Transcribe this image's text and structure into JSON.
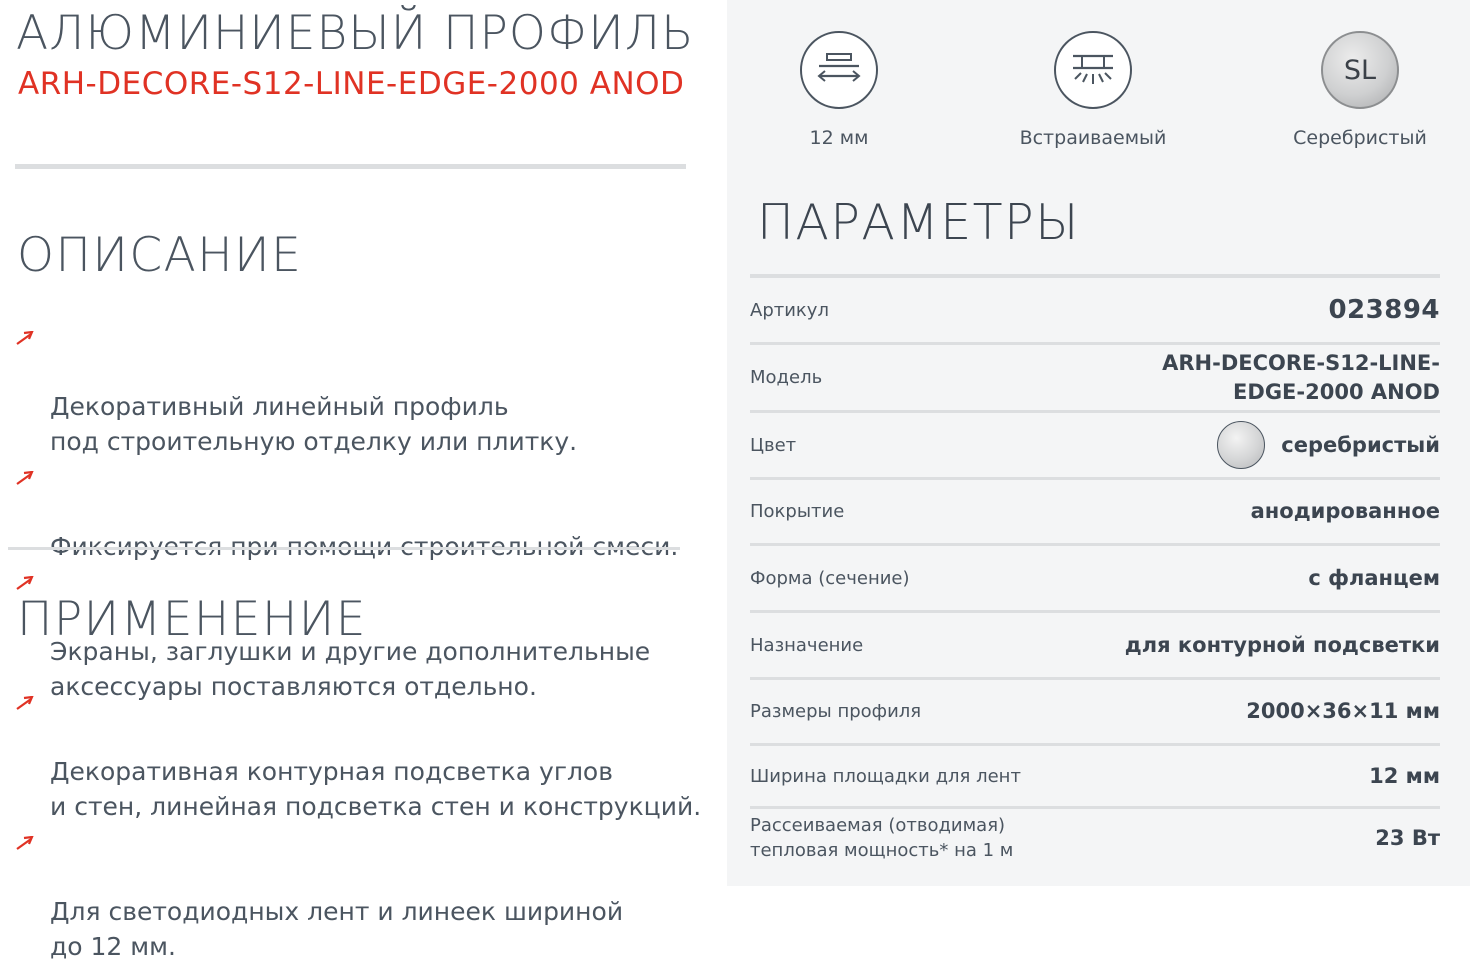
{
  "header": {
    "title": "АЛЮМИНИЕВЫЙ ПРОФИЛЬ",
    "model": "ARH-DECORE-S12-LINE-EDGE-2000 ANOD"
  },
  "description": {
    "title": "ОПИСАНИЕ",
    "items": [
      "Декоративный линейный профиль\nпод строительную отделку или плитку.",
      "Фиксируется при помощи строительной смеси.",
      "Экраны, заглушки и другие дополнительные\nаксессуары поставляются отдельно."
    ]
  },
  "application": {
    "title": "ПРИМЕНЕНИЕ",
    "items": [
      "Декоративная контурная подсветка углов\nи стен, линейная подсветка стен и конструкций.",
      "Для светодиодных лент и линеек шириной\nдо 12 мм."
    ]
  },
  "features": [
    {
      "icon": "width-arrows-icon",
      "label": "12 мм"
    },
    {
      "icon": "recessed-mount-icon",
      "label": "Встраиваемый"
    },
    {
      "icon": "silver-color-icon",
      "badge": "SL",
      "label": "Серебристый"
    }
  ],
  "params": {
    "title": "ПАРАМЕТРЫ",
    "rows": [
      {
        "name": "Артикул",
        "value": "023894"
      },
      {
        "name": "Модель",
        "value": "ARH-DECORE-S12-LINE-\nEDGE-2000 ANOD"
      },
      {
        "name": "Цвет",
        "value": "серебристый"
      },
      {
        "name": "Покрытие",
        "value": "анодированное"
      },
      {
        "name": "Форма (сечение)",
        "value": "с фланцем"
      },
      {
        "name": "Назначение",
        "value": "для контурной подсветки"
      },
      {
        "name": "Размеры профиля",
        "value": "2000×36×11 мм"
      },
      {
        "name": "Ширина площадки для лент",
        "value": "12 мм"
      },
      {
        "name": "Рассеиваемая (отводимая)\nтепловая мощность* на 1 м",
        "value": "23 Вт"
      }
    ]
  },
  "colors": {
    "accent": "#e03224",
    "text": "#4b5560",
    "panel": "#f4f5f6",
    "divider": "#dcdee0"
  }
}
